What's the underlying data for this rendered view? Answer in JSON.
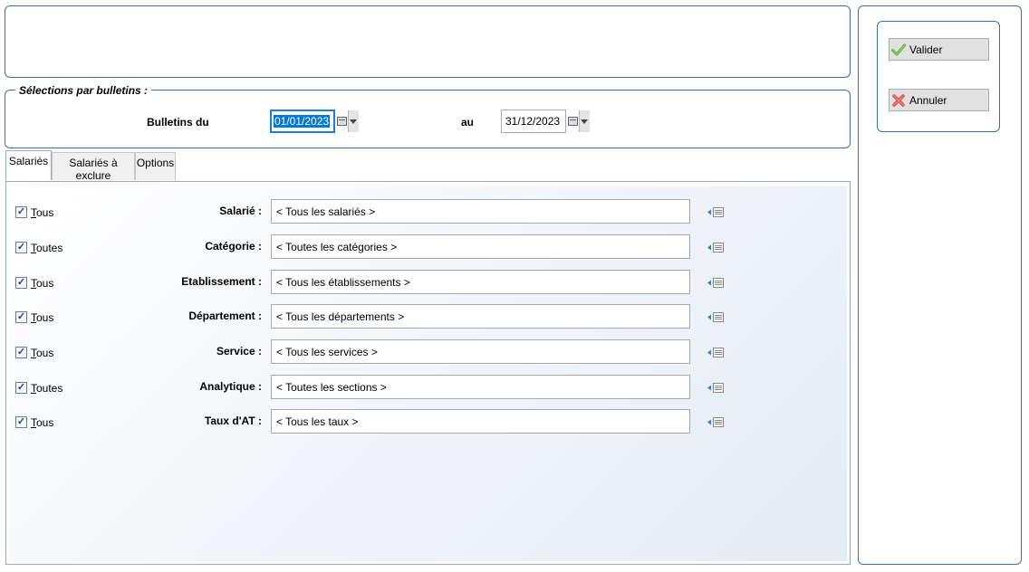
{
  "selection_group": {
    "legend": "Sélections par bulletins :",
    "from_label": "Bulletins du",
    "from_date": "01/01/2023",
    "to_label": "au",
    "to_date": "31/12/2023"
  },
  "tabs": [
    {
      "label": "Salariés",
      "active": true
    },
    {
      "label": "Salariés à exclure",
      "active": false
    },
    {
      "label": "Options",
      "active": false
    }
  ],
  "rows": [
    {
      "check_label": "Tous",
      "checked": true,
      "label": "Salarié :",
      "value": "< Tous les salariés >"
    },
    {
      "check_label": "Toutes",
      "checked": true,
      "label": "Catégorie :",
      "value": "< Toutes les catégories >"
    },
    {
      "check_label": "Tous",
      "checked": true,
      "label": "Etablissement :",
      "value": "< Tous les établissements >"
    },
    {
      "check_label": "Tous",
      "checked": true,
      "label": "Département :",
      "value": "< Tous les départements >"
    },
    {
      "check_label": "Tous",
      "checked": true,
      "label": "Service :",
      "value": "< Tous les services >"
    },
    {
      "check_label": "Toutes",
      "checked": true,
      "label": "Analytique :",
      "value": "< Toutes les sections >"
    },
    {
      "check_label": "Tous",
      "checked": true,
      "label": "Taux d'AT :",
      "value": "< Tous les taux >"
    }
  ],
  "buttons": {
    "validate_label": "Valider",
    "cancel_label": "Annuler"
  },
  "colors": {
    "frame_border": "#3b6fa5",
    "focus_border": "#1e7bd6",
    "checkbox_border": "#5a7fb5",
    "validate_icon": "#5aa832",
    "cancel_icon": "#e0453a"
  },
  "icons": {
    "calendar": "calendar-icon",
    "dropdown": "chevron-down-icon",
    "checkbox": "checkmark-icon",
    "list_picker": "list-picker-icon",
    "validate": "checkmark-icon",
    "cancel": "cross-icon"
  }
}
